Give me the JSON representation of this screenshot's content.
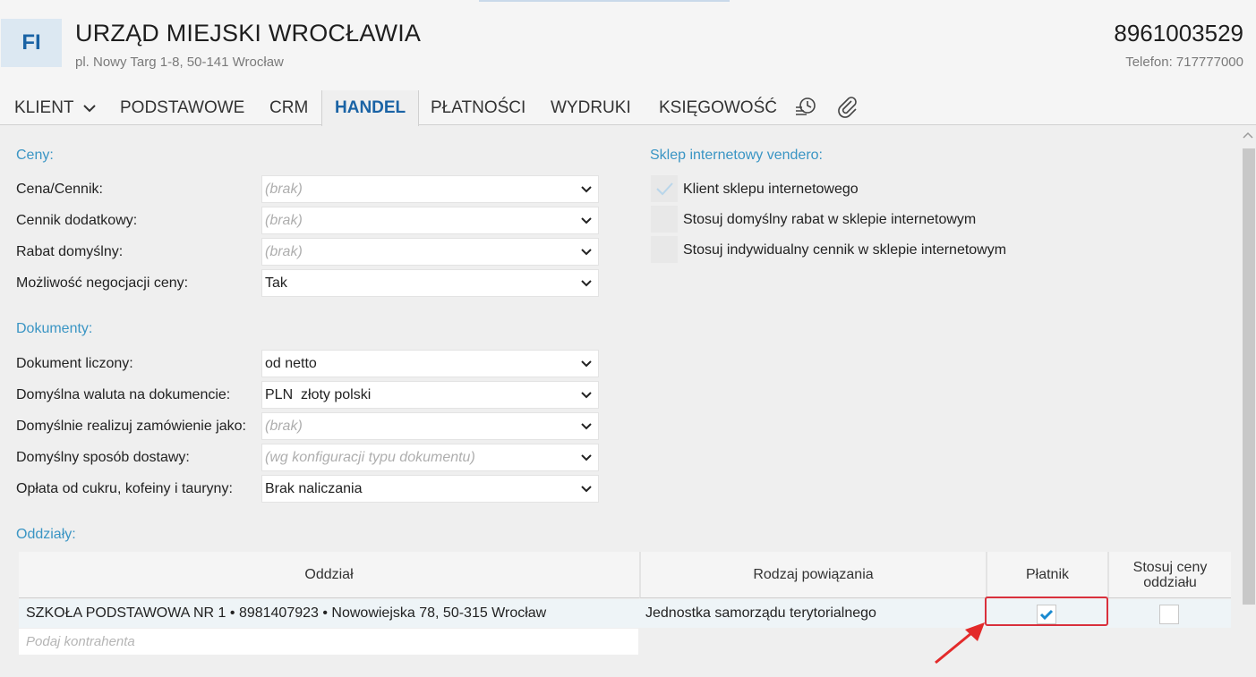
{
  "header": {
    "avatar_initials": "FI",
    "title": "URZĄD MIEJSKI WROCŁAWIA",
    "address": "pl. Nowy Targ 1-8, 50-141 Wrocław",
    "nip": "8961003529",
    "phone": "Telefon: 717777000"
  },
  "tabs": {
    "klient": "KLIENT",
    "podstawowe": "PODSTAWOWE",
    "crm": "CRM",
    "handel": "HANDEL",
    "platnosci": "PŁATNOŚCI",
    "wydruki": "WYDRUKI",
    "ksiegowosc": "KSIĘGOWOŚĆ",
    "active": "HANDEL"
  },
  "ceny": {
    "title": "Ceny:",
    "cena_cennik_label": "Cena/Cennik:",
    "cena_cennik_value": "(brak)",
    "cennik_dodatkowy_label": "Cennik dodatkowy:",
    "cennik_dodatkowy_value": "(brak)",
    "rabat_label": "Rabat domyślny:",
    "rabat_value": "(brak)",
    "negocjacja_label": "Możliwość negocjacji ceny:",
    "negocjacja_value": "Tak"
  },
  "dokumenty": {
    "title": "Dokumenty:",
    "liczony_label": "Dokument liczony:",
    "liczony_value": "od netto",
    "waluta_label": "Domyślna waluta na dokumencie:",
    "waluta_value": "PLN  złoty polski",
    "realizuj_label": "Domyślnie realizuj zamówienie jako:",
    "realizuj_value": "(brak)",
    "dostawa_label": "Domyślny sposób dostawy:",
    "dostawa_value": "(wg konfiguracji typu dokumentu)",
    "oplata_label": "Opłata od cukru, kofeiny i tauryny:",
    "oplata_value": "Brak naliczania"
  },
  "sklep": {
    "title": "Sklep internetowy vendero:",
    "klient_label": "Klient sklepu internetowego",
    "klient_checked": true,
    "rabat_label": "Stosuj domyślny rabat w sklepie internetowym",
    "rabat_checked": false,
    "cennik_label": "Stosuj indywidualny cennik w sklepie internetowym",
    "cennik_checked": false
  },
  "oddzialy": {
    "title": "Oddziały:",
    "columns": {
      "oddzial": "Oddział",
      "rodzaj": "Rodzaj powiązania",
      "platnik": "Płatnik",
      "stosuj_line1": "Stosuj ceny",
      "stosuj_line2": "oddziału"
    },
    "rows": [
      {
        "oddzial": "SZKOŁA PODSTAWOWA NR 1  • 8981407923 • Nowowiejska 78, 50-315 Wrocław",
        "rodzaj": "Jednostka samorządu terytorialnego",
        "platnik": true,
        "stosuj_ceny": false
      }
    ],
    "new_placeholder": "Podaj kontrahenta"
  },
  "colors": {
    "accent": "#1a63a5",
    "section": "#3a95c4",
    "highlight": "#d9303c"
  }
}
